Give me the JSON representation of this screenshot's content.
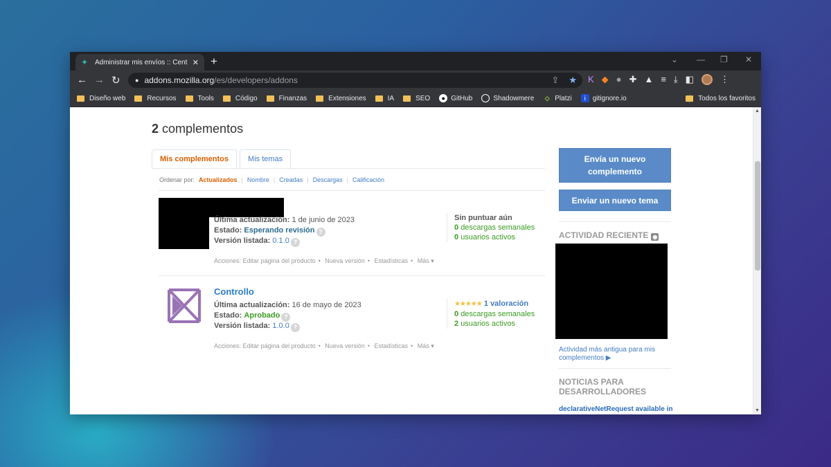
{
  "browser": {
    "tab_title": "Administrar mis envíos :: Centro d",
    "url_host": "addons.mozilla.org",
    "url_path": "/es/developers/addons",
    "bookmarks": [
      {
        "label": "Diseño web",
        "type": "folder"
      },
      {
        "label": "Recursos",
        "type": "folder"
      },
      {
        "label": "Tools",
        "type": "folder"
      },
      {
        "label": "Código",
        "type": "folder"
      },
      {
        "label": "Finanzas",
        "type": "folder"
      },
      {
        "label": "Extensiones",
        "type": "folder"
      },
      {
        "label": "IA",
        "type": "folder"
      },
      {
        "label": "SEO",
        "type": "folder"
      },
      {
        "label": "GitHub",
        "type": "github-icon"
      },
      {
        "label": "Shadowmere",
        "type": "shadowmere-icon"
      },
      {
        "label": "Platzi",
        "type": "platzi-icon"
      },
      {
        "label": "gitignore.io",
        "type": "gitignore-icon"
      }
    ],
    "all_bookmarks": "Todos los favoritos"
  },
  "page": {
    "count": "2",
    "count_label": "complementos",
    "tabs": [
      "Mis complementos",
      "Mis temas"
    ],
    "sort_label": "Ordenar por:",
    "sort_options": [
      "Actualizados",
      "Nombre",
      "Creadas",
      "Descargas",
      "Calificación"
    ],
    "addons": [
      {
        "name": "",
        "updated_label": "Última actualización:",
        "updated": "1 de junio de 2023",
        "status_label": "Estado:",
        "status": "Esperando revisión",
        "version_label": "Versión listada:",
        "version": "0.1.0",
        "rating": "Sin puntuar aún",
        "weekly_count": "0",
        "weekly_label": "descargas semanales",
        "users_count": "0",
        "users_label": "usuarios activos",
        "actions_label": "Acciones:",
        "actions": [
          "Editar página del producto",
          "Nueva versión",
          "Estadísticas",
          "Más ▾"
        ]
      },
      {
        "name": "Controllo",
        "updated_label": "Última actualización:",
        "updated": "16 de mayo de 2023",
        "status_label": "Estado:",
        "status": "Aprobado",
        "version_label": "Versión listada:",
        "version": "1.0.0",
        "rating_stars": 5,
        "rating": "1 valoración",
        "weekly_count": "0",
        "weekly_label": "descargas semanales",
        "users_count": "2",
        "users_label": "usuarios activos",
        "actions_label": "Acciones:",
        "actions": [
          "Editar página del producto",
          "Nueva versión",
          "Estadísticas",
          "Más ▾"
        ]
      }
    ]
  },
  "sidebar": {
    "submit_addon": "Envía un nuevo complemento",
    "submit_theme": "Enviar un nuevo tema",
    "recent_activity": "ACTIVIDAD RECIENTE",
    "older_activity": "Actividad más antigua para mis complementos ▶",
    "news_title": "NOTICIAS PARA DESARROLLADORES",
    "news_item": "declarativeNetRequest available in"
  },
  "colors": {
    "accent_orange": "#d65f00",
    "link_blue": "#447bc4",
    "button_blue": "#5a8bc8",
    "green": "#3a9c22"
  }
}
